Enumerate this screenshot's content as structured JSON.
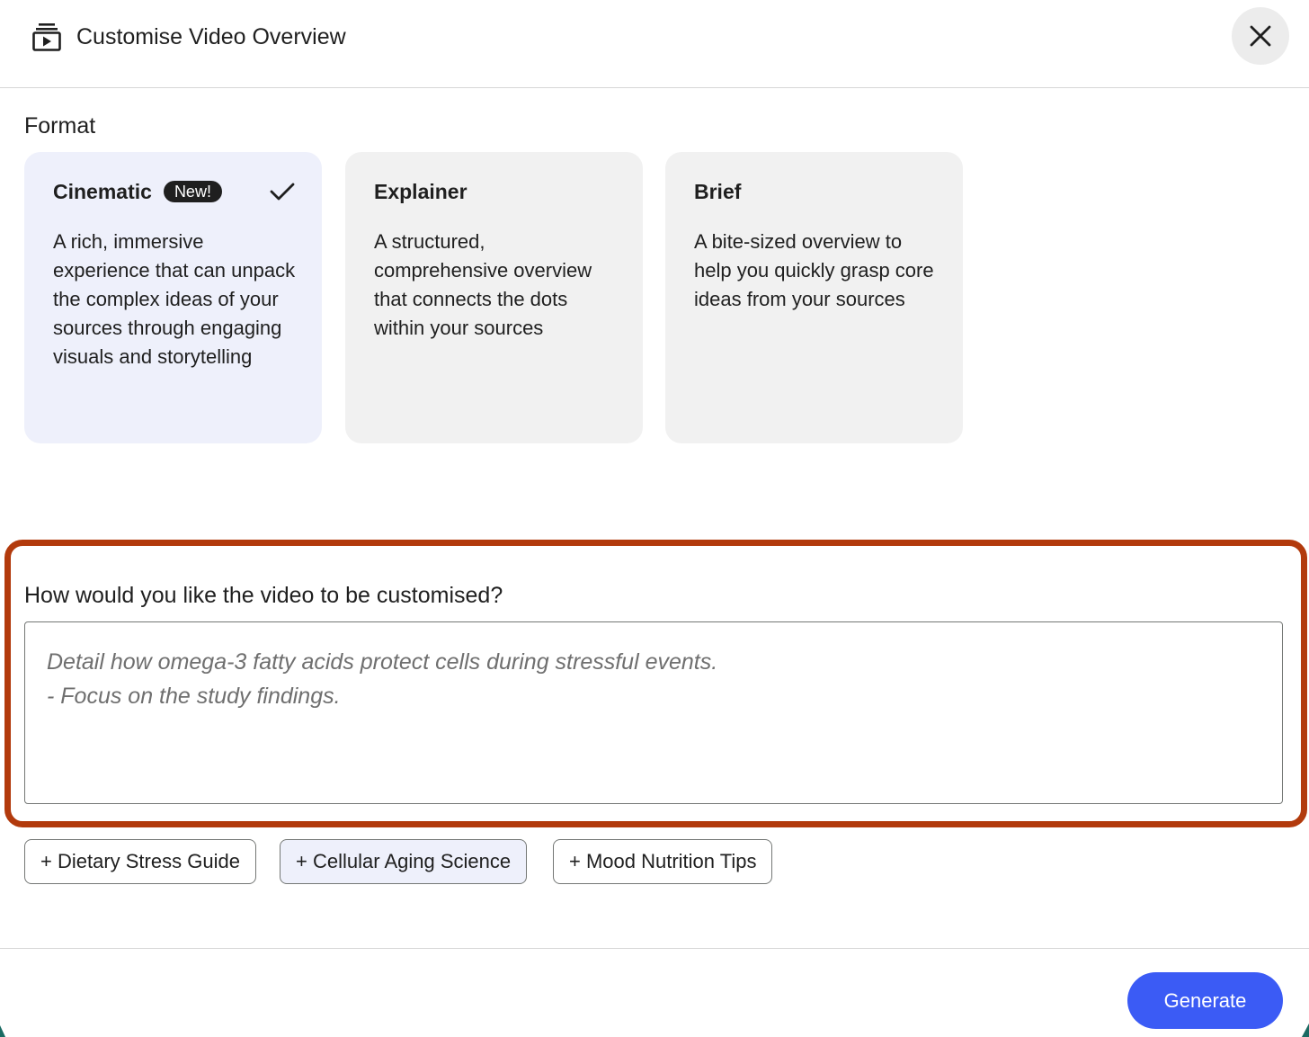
{
  "header": {
    "title": "Customise Video Overview",
    "icon": "video-stack-icon"
  },
  "format": {
    "label": "Format",
    "cards": [
      {
        "title": "Cinematic",
        "badge": "New!",
        "selected": true,
        "description": "A rich, immersive experience that can unpack the complex ideas of your sources through engaging visuals and storytelling"
      },
      {
        "title": "Explainer",
        "selected": false,
        "description": "A structured, comprehensive overview that connects the dots within your sources"
      },
      {
        "title": "Brief",
        "selected": false,
        "description": "A bite-sized overview to help you quickly grasp core ideas from your sources"
      }
    ]
  },
  "customise": {
    "question": "How would you like the video to be customised?",
    "placeholder": "Detail how omega-3 fatty acids protect cells during stressful events.\n- Focus on the study findings.",
    "value": ""
  },
  "suggestions": [
    {
      "label": "+ Dietary Stress Guide",
      "active": false
    },
    {
      "label": "+ Cellular Aging Science",
      "active": true
    },
    {
      "label": "+ Mood Nutrition Tips",
      "active": false
    }
  ],
  "footer": {
    "generate_label": "Generate"
  },
  "colors": {
    "accent": "#3b5bf5",
    "highlight_border": "#b23a0c",
    "selected_card": "#eef0fb",
    "card": "#f1f1f1"
  }
}
